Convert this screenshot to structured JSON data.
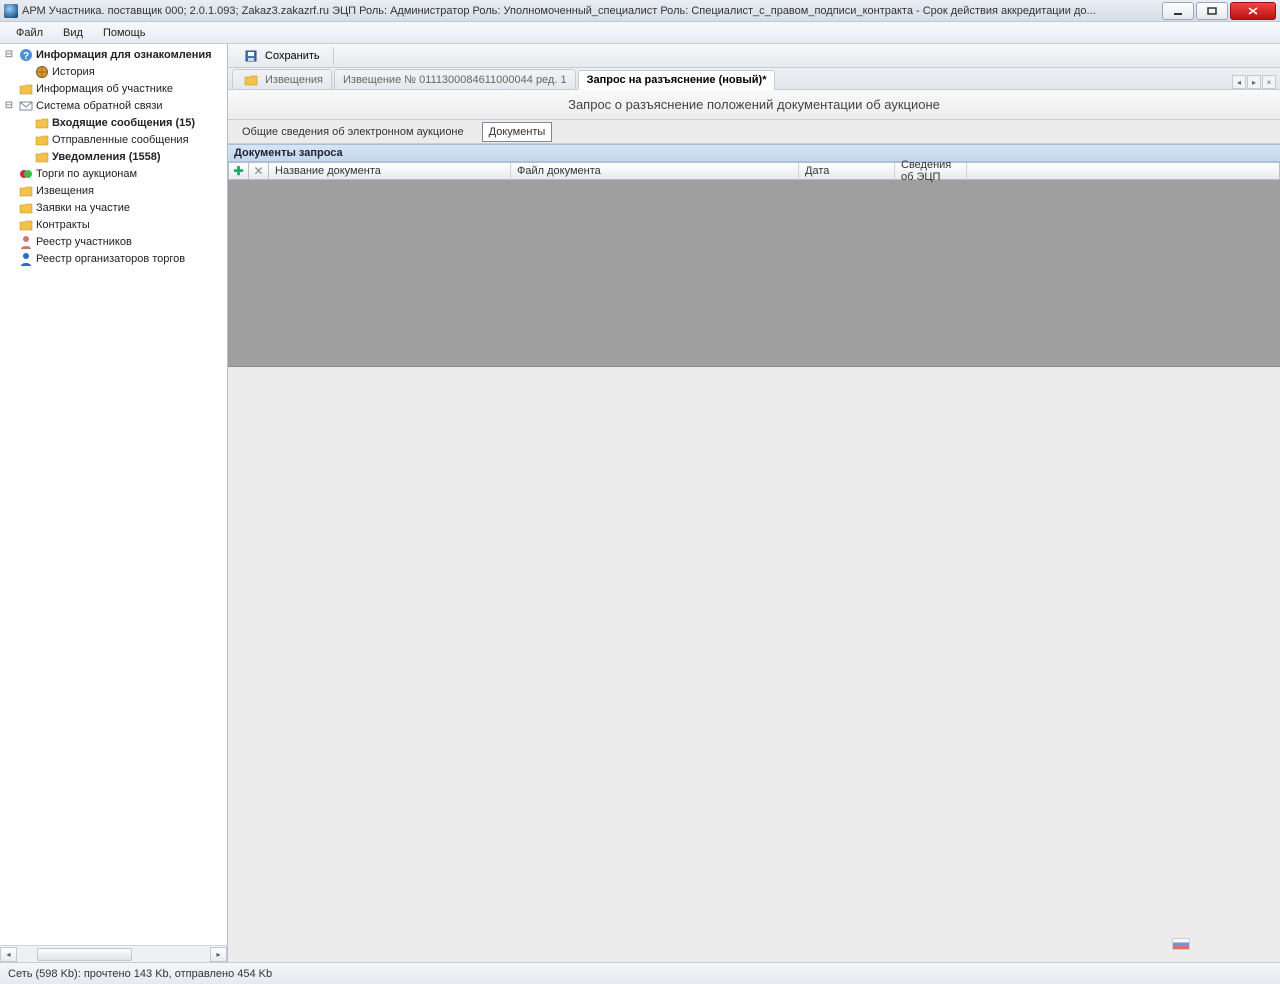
{
  "window": {
    "title": "АРМ Участника. поставщик 000; 2.0.1.093; Zakaz3.zakazrf.ru  ЭЦП Роль: Администратор Роль: Уполномоченный_специалист Роль: Специалист_с_правом_подписи_контракта - Срок действия аккредитации до..."
  },
  "menu": {
    "file": "Файл",
    "view": "Вид",
    "help": "Помощь"
  },
  "tree": {
    "info_root": "Информация для ознакомления",
    "history": "История",
    "participant_info": "Информация об участнике",
    "feedback": "Система обратной связи",
    "inbox": "Входящие сообщения (15)",
    "sent": "Отправленные сообщения",
    "notifications": "Уведомления (1558)",
    "auctions": "Торги по аукционам",
    "notices": "Извещения",
    "applications": "Заявки на участие",
    "contracts": "Контракты",
    "participants_registry": "Реестр участников",
    "organizers_registry": "Реестр организаторов торгов"
  },
  "toolbar": {
    "save": "Сохранить"
  },
  "doc_tabs": {
    "t1": "Извещения",
    "t2": "Извещение № 0111300084611000044 ред. 1",
    "t3": "Запрос на разъяснение (новый)*"
  },
  "page": {
    "title": "Запрос о разъяснение положений документации об аукционе"
  },
  "sub_tabs": {
    "general": "Общие сведения об электронном аукционе",
    "documents": "Документы"
  },
  "section": {
    "header": "Документы запроса"
  },
  "grid": {
    "col_name": "Название документа",
    "col_file": "Файл документа",
    "col_date": "Дата",
    "col_ecp": "Сведения об ЭЦП"
  },
  "status": {
    "text": "Сеть (598 Kb):  прочтено 143 Kb, отправлено 454 Kb"
  }
}
